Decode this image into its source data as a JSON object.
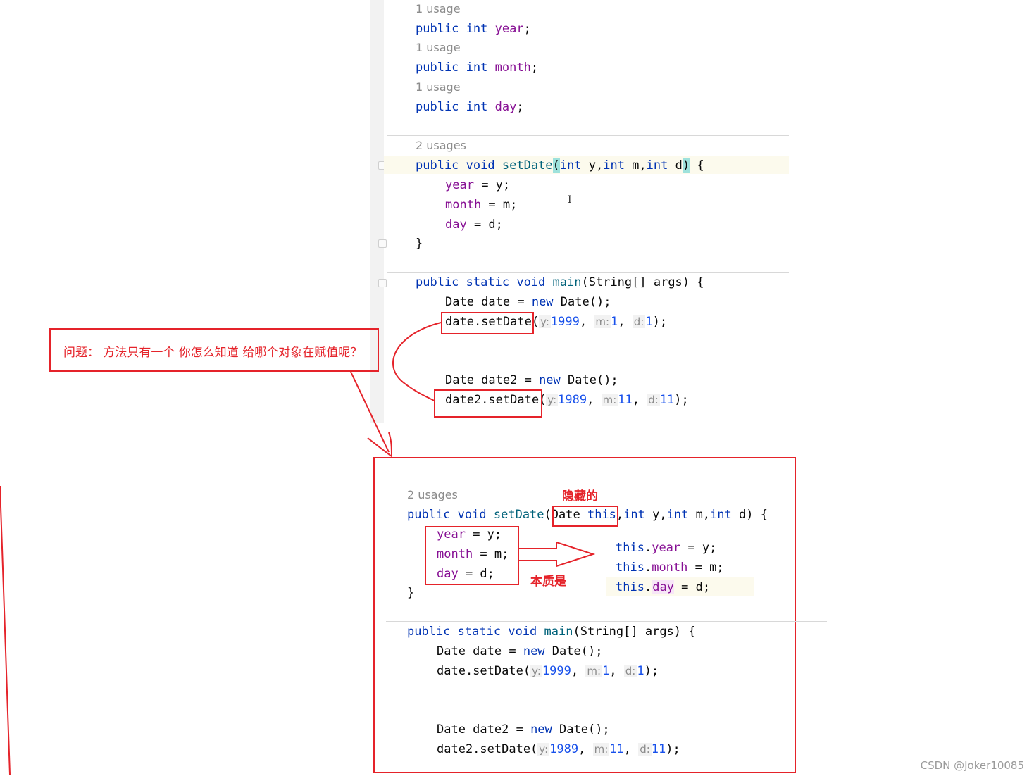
{
  "top": {
    "usage_1": "1 usage",
    "usage_2": "1 usage",
    "usage_3": "1 usage",
    "usages": "2 usages",
    "decl_public": "public",
    "decl_int": "int",
    "field_year": "year",
    "field_month": "month",
    "field_day": "day",
    "semicolon": ";",
    "setdate_sig": {
      "public": "public",
      "void": "void",
      "name": "setDate",
      "open": "(",
      "int1": "int",
      "p1": " y,",
      "int2": "int",
      "p2": " m,",
      "int3": "int",
      "p3": " d",
      "close": ")",
      "brace": " {"
    },
    "assign_year": " = y;",
    "assign_month": " = m;",
    "assign_day": " = d;",
    "close_brace": "}",
    "main_sig": {
      "public": "public",
      "static": "static",
      "void": "void",
      "name": "main",
      "rest": "(String[] args) {"
    },
    "date_decl_a": "Date date = ",
    "new": "new",
    "date_decl_b": " Date();",
    "call1": "date.setDate(",
    "call2": "date2.setDate(",
    "date2_decl_a": "Date date2 = ",
    "hint_y": "y:",
    "hint_m": "m:",
    "hint_d": "d:",
    "c1_y": "1999",
    "c1_m": "1",
    "c1_d": "1",
    "c2_y": "1989",
    "c2_m": "11",
    "c2_d": "11",
    "comma": ", ",
    "close_call": ");"
  },
  "annotation": {
    "question": "问题： 方法只有一个 你怎么知道 给哪个对象在赋值呢？",
    "hidden": "隐藏的",
    "essence": "本质是"
  },
  "bottom": {
    "usages": "2 usages",
    "sig_public": "public",
    "sig_void": "void",
    "sig_name": "setDate",
    "sig_open": "(",
    "sig_date": "Date ",
    "sig_this": "this",
    "sig_comma": ",",
    "sig_int1": "int",
    "sig_p1": " y,",
    "sig_int2": "int",
    "sig_p2": " m,",
    "sig_int3": "int",
    "sig_p3": " d) {",
    "this_kw": "this",
    "dot": ".",
    "year": "year",
    "month": "month",
    "day": "day",
    "assign_y": " = y;",
    "assign_m": " = m;",
    "assign_d": " = d;",
    "close_brace": "}"
  },
  "watermark": "CSDN @Joker10085",
  "colors": {
    "annotation_red": "#e5232a",
    "keyword_blue": "#0033b3",
    "field_purple": "#871094",
    "method_teal": "#00627a",
    "number_blue": "#1750eb"
  }
}
